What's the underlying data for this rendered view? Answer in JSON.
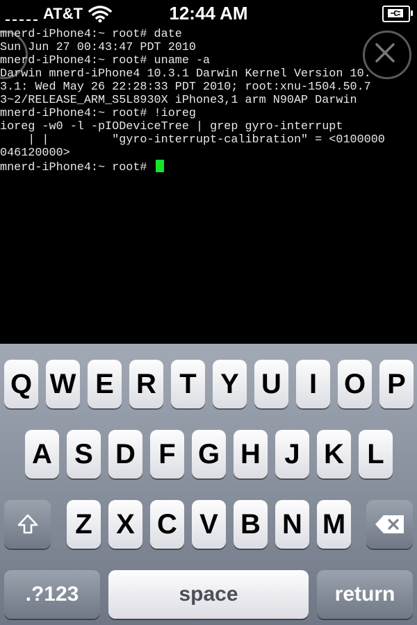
{
  "status_bar": {
    "carrier": "AT&T",
    "time": "12:44 AM",
    "icons": [
      "signal-dots-icon",
      "wifi-icon",
      "battery-charging-icon"
    ]
  },
  "terminal": {
    "lines": [
      "mnerd-iPhone4:~ root# date",
      "Sun Jun 27 00:43:47 PDT 2010",
      "mnerd-iPhone4:~ root# uname -a",
      "Darwin mnerd-iPhone4 10.3.1 Darwin Kernel Version 10.",
      "3.1: Wed May 26 22:28:33 PDT 2010; root:xnu-1504.50.7",
      "3~2/RELEASE_ARM_S5L8930X iPhone3,1 arm N90AP Darwin",
      "mnerd-iPhone4:~ root# !ioreg",
      "ioreg -w0 -l -pIODeviceTree | grep gyro-interrupt",
      "    | |         \"gyro-interrupt-calibration\" = <0100000",
      "046120000>",
      "mnerd-iPhone4:~ root# "
    ],
    "cursor_color": "#19e22a"
  },
  "overlay_buttons": {
    "left_icon": "circle-button-icon",
    "close_icon": "close-icon"
  },
  "keyboard": {
    "row1": [
      "Q",
      "W",
      "E",
      "R",
      "T",
      "Y",
      "U",
      "I",
      "O",
      "P"
    ],
    "row2": [
      "A",
      "S",
      "D",
      "F",
      "G",
      "H",
      "J",
      "K",
      "L"
    ],
    "row3": [
      "Z",
      "X",
      "C",
      "V",
      "B",
      "N",
      "M"
    ],
    "shift_icon": "shift-arrow-icon",
    "backspace_icon": "delete-backspace-icon",
    "numbers_label": ".?123",
    "space_label": "space",
    "return_label": "return"
  }
}
